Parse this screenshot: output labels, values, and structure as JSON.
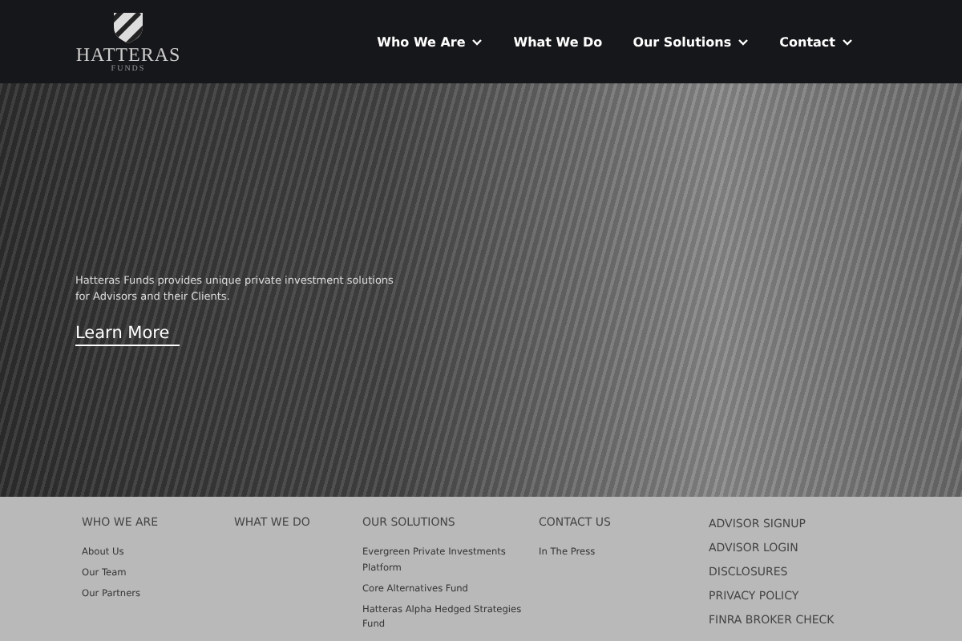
{
  "header": {
    "logo": {
      "name": "HATTERAS",
      "sub": "FUNDS"
    },
    "nav": [
      {
        "label": "Who We Are",
        "dropdown": true
      },
      {
        "label": "What We Do",
        "dropdown": false
      },
      {
        "label": "Our Solutions",
        "dropdown": true
      },
      {
        "label": "Contact",
        "dropdown": true
      }
    ]
  },
  "hero": {
    "text": "Hatteras Funds provides unique private investment solutions for Advisors and their Clients.",
    "link": "Learn More"
  },
  "footer": {
    "columns": [
      {
        "heading": "WHO WE ARE",
        "links": [
          "About Us",
          "Our Team",
          "Our Partners"
        ]
      },
      {
        "heading": "WHAT WE DO"
      },
      {
        "heading": "OUR SOLUTIONS",
        "links": [
          "Evergreen Private Investments Platform",
          "Core Alternatives Fund",
          "Hatteras Alpha Hedged Strategies Fund"
        ]
      },
      {
        "heading": "CONTACT US",
        "links": [
          "In The Press"
        ]
      }
    ],
    "quick_links": [
      "ADVISOR SIGNUP",
      "ADVISOR LOGIN",
      "DISCLOSURES",
      "PRIVACY POLICY",
      "FINRA BROKER CHECK"
    ]
  }
}
